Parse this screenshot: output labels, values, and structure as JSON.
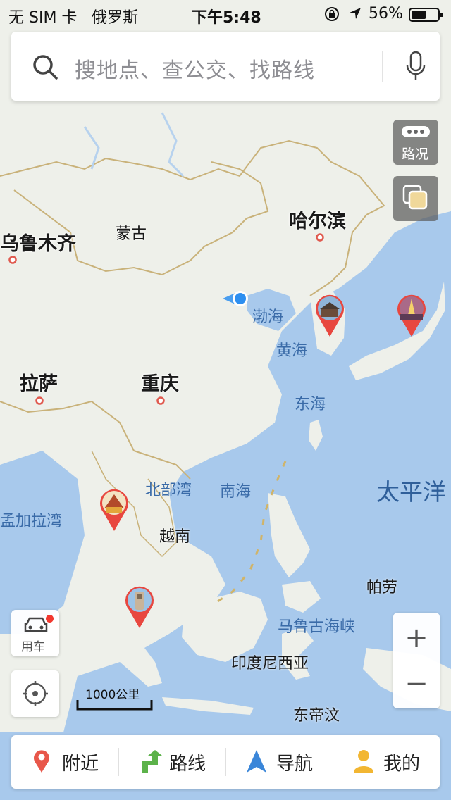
{
  "status_bar": {
    "carrier": "无 SIM 卡",
    "location": "俄罗斯",
    "time": "下午5:48",
    "battery": "56%",
    "battery_level": 0.56
  },
  "search": {
    "placeholder": "搜地点、查公交、找路线",
    "icon": "search-icon",
    "voice_icon": "microphone-icon"
  },
  "controls": {
    "traffic_label": "路况",
    "car_label": "用车",
    "scale_label": "1000公里",
    "zoom_in": "+",
    "zoom_out": "−"
  },
  "map": {
    "cities": [
      "乌鲁木齐",
      "哈尔滨",
      "拉萨",
      "重庆"
    ],
    "countries": [
      "蒙古",
      "越南",
      "帕劳",
      "印度尼西亚",
      "东帝汶"
    ],
    "seas": [
      "渤海",
      "黄海",
      "东海",
      "北部湾",
      "南海",
      "马鲁古海峡",
      "孟加拉湾"
    ],
    "ocean": "太平洋",
    "colors": {
      "land": "#eef0ea",
      "water": "#a8c9ec",
      "border": "#c9b27a",
      "pin": "#e8473f",
      "location": "#2d8ff0"
    }
  },
  "bottom_nav": [
    {
      "label": "附近",
      "icon": "location-pin-icon"
    },
    {
      "label": "路线",
      "icon": "route-arrow-icon"
    },
    {
      "label": "导航",
      "icon": "navigation-arrow-icon"
    },
    {
      "label": "我的",
      "icon": "user-icon"
    }
  ]
}
